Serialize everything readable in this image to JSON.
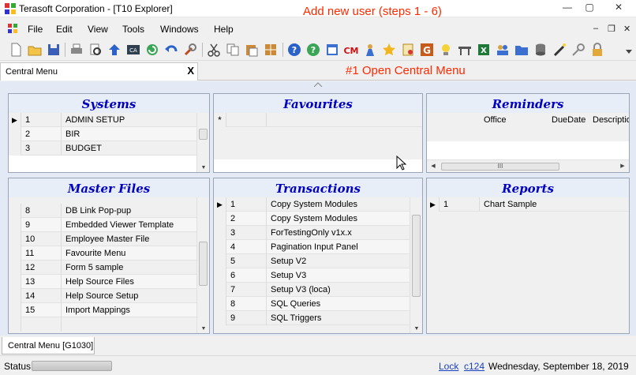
{
  "window": {
    "title": "Terasoft Corporation - [T10 Explorer]",
    "overlay_caption": "Add new user  (steps 1 - 6)",
    "controls": {
      "minimize": "—",
      "maximize": "▢",
      "close": "✕"
    }
  },
  "menubar": {
    "items": [
      "File",
      "Edit",
      "View",
      "Tools",
      "Windows",
      "Help"
    ],
    "mdi_controls": {
      "minimize": "–",
      "restore": "❐",
      "close": "✕"
    }
  },
  "toolbar": {
    "icons": [
      "new-document-icon",
      "open-folder-icon",
      "save-icon",
      "print-icon",
      "print-preview-icon",
      "upload-arrow-icon",
      "cash-icon",
      "refresh-icon",
      "undo-icon",
      "tools-icon",
      "cut-icon",
      "copy-icon",
      "paste-icon",
      "grid-icon",
      "help-icon",
      "info-icon",
      "calendar-icon",
      "cm-icon",
      "person-icon",
      "star-icon",
      "certificate-icon",
      "g-icon",
      "lightbulb-icon",
      "desk-icon",
      "excel-icon",
      "users-icon",
      "folder-icon",
      "database-icon",
      "wand-icon",
      "key-icon",
      "lock-icon"
    ]
  },
  "doc_tab": {
    "label": "Central Menu",
    "close": "X"
  },
  "step_caption": "#1 Open Central Menu",
  "panels": {
    "systems": {
      "title": "Systems",
      "rows": [
        {
          "num": "1",
          "name": "ADMIN SETUP",
          "current": true
        },
        {
          "num": "2",
          "name": "BIR"
        },
        {
          "num": "3",
          "name": "BUDGET"
        }
      ]
    },
    "favourites": {
      "title": "Favourites",
      "new_row_marker": "*"
    },
    "reminders": {
      "title": "Reminders",
      "columns": [
        "Office",
        "DueDate",
        "Descriptio"
      ],
      "hscroll_grip": "III"
    },
    "master_files": {
      "title": "Master Files",
      "rows": [
        {
          "num": "8",
          "name": "DB Link Pop-pup"
        },
        {
          "num": "9",
          "name": "Embedded Viewer Template"
        },
        {
          "num": "10",
          "name": "Employee Master File"
        },
        {
          "num": "11",
          "name": "Favourite Menu"
        },
        {
          "num": "12",
          "name": "Form 5 sample"
        },
        {
          "num": "13",
          "name": "Help Source Files"
        },
        {
          "num": "14",
          "name": "Help Source Setup"
        },
        {
          "num": "15",
          "name": "Import Mappings"
        }
      ]
    },
    "transactions": {
      "title": "Transactions",
      "rows": [
        {
          "num": "1",
          "name": "Copy System Modules",
          "current": true
        },
        {
          "num": "2",
          "name": "Copy System Modules"
        },
        {
          "num": "3",
          "name": "ForTestingOnly v1x.x"
        },
        {
          "num": "4",
          "name": "Pagination Input Panel"
        },
        {
          "num": "5",
          "name": "Setup V2"
        },
        {
          "num": "6",
          "name": "Setup V3"
        },
        {
          "num": "7",
          "name": "Setup V3 (loca)"
        },
        {
          "num": "8",
          "name": "SQL Queries"
        },
        {
          "num": "9",
          "name": "SQL Triggers"
        }
      ]
    },
    "reports": {
      "title": "Reports",
      "rows": [
        {
          "num": "1",
          "name": "Chart Sample",
          "current": true
        }
      ]
    }
  },
  "bottom_tab": {
    "label": "Central Menu [G1030]"
  },
  "statusbar": {
    "label": "Status",
    "lock_link": "Lock",
    "user_link": "c124",
    "date": "Wednesday, September 18, 2019"
  },
  "colors": {
    "panel_title": "#0000c0",
    "caption_red": "#ff2a00",
    "link_blue": "#1a3fbf",
    "content_bg": "#e4eaf5"
  }
}
